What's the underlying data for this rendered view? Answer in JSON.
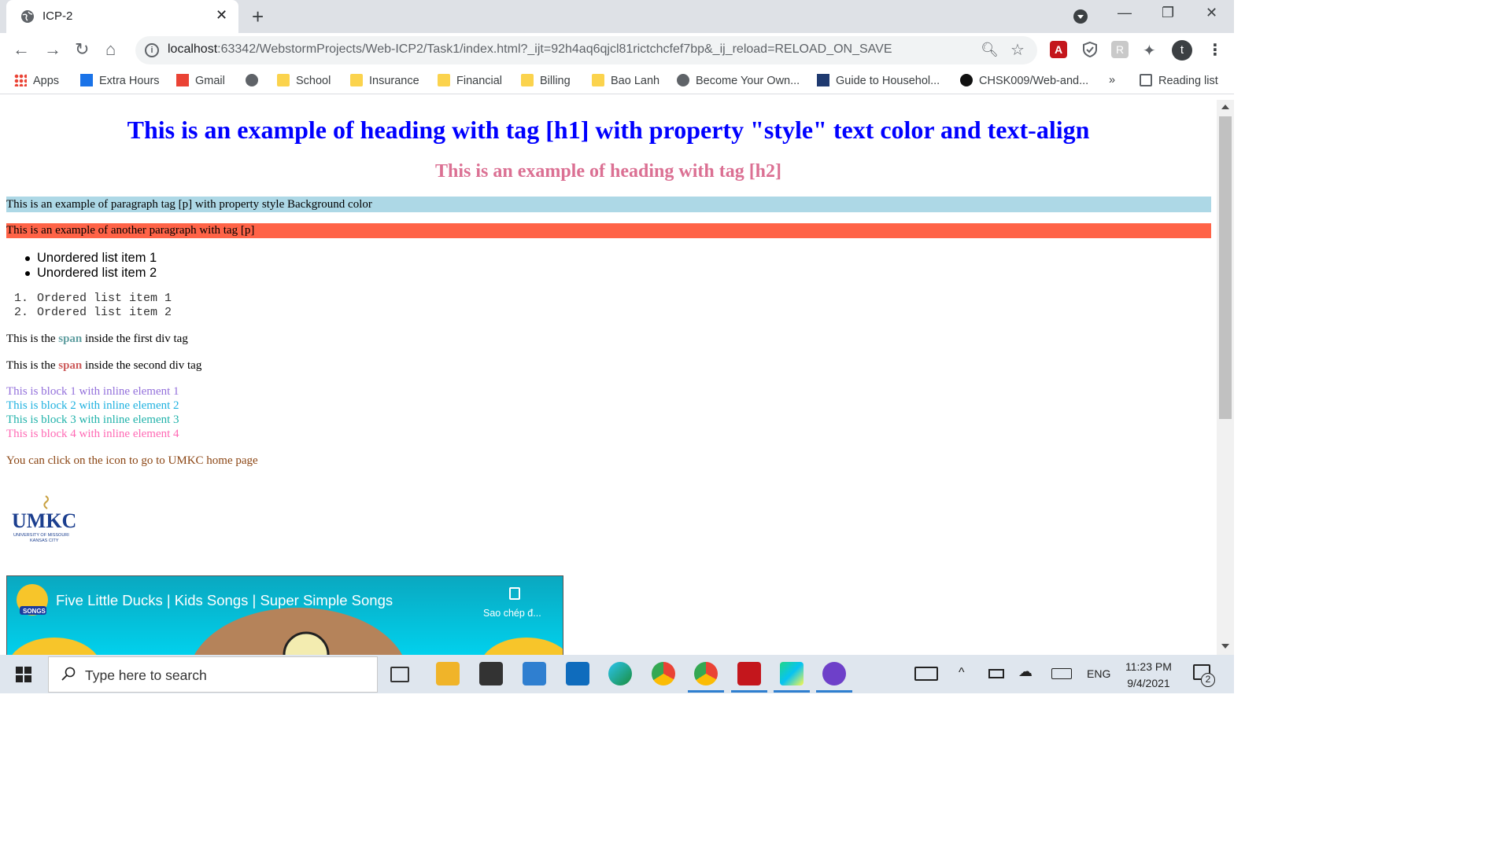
{
  "browser": {
    "tab_title": "ICP-2",
    "new_tab": "+",
    "url_host": "localhost",
    "url_rest": ":63342/WebstormProjects/Web-ICP2/Task1/index.html?_ijt=92h4aq6qjcl81rictchcfef7bp&_ij_reload=RELOAD_ON_SAVE",
    "profile_initial": "t",
    "pdf_ext": "A",
    "r_ext": "R"
  },
  "bookmarks": {
    "apps": "Apps",
    "extra_hours": "Extra Hours",
    "gmail": "Gmail",
    "school": "School",
    "insurance": "Insurance",
    "financial": "Financial",
    "billing": "Billing",
    "bao_lanh": "Bao Lanh",
    "become": "Become Your Own...",
    "guide": "Guide to Househol...",
    "chsk": "CHSK009/Web-and...",
    "more": "»",
    "reading_list": "Reading list"
  },
  "page": {
    "h1": "This is an example of heading with tag [h1] with property \"style\" text color and text-align",
    "h2": "This is an example of heading with tag [h2]",
    "p1": "This is an example of paragraph tag [p] with property style Background color",
    "p2": "This is an example of another paragraph with tag [p]",
    "ul": [
      "Unordered list item 1",
      "Unordered list item 2"
    ],
    "ol": [
      "Ordered list item 1",
      "Ordered list item 2"
    ],
    "ol_nums": [
      "1.",
      "2."
    ],
    "div1_pre": "This is the ",
    "div1_span": "span",
    "div1_post": " inside the first div tag",
    "div2_pre": "This is the ",
    "div2_span": "span",
    "div2_post": " inside the second div tag",
    "blocks": [
      "This is block 1 with inline element 1",
      "This is block 2 with inline element 2",
      "This is block 3 with inline element 3",
      "This is block 4 with inline element 4"
    ],
    "umkc_note": "You can click on the icon to go to UMKC home page",
    "logo_text": "UMKC",
    "logo_sub1": "UNIVERSITY OF MISSOURI",
    "logo_sub2": "KANSAS CITY",
    "video_title": "Five Little Ducks | Kids Songs | Super Simple Songs",
    "video_copy": "Sao chép đ...",
    "video_badge": "SONGS"
  },
  "colors": {
    "h1": "#0000ff",
    "h2": "#db7093",
    "p1_bg": "#add8e6",
    "p2_bg": "#ff6347",
    "span1": "#5f9ea0",
    "span2": "#cd5c5c",
    "block1": "#9370db",
    "block2": "#20b2e0",
    "block3": "#20b2aa",
    "block4": "#ff69b4",
    "umkc_note": "#8b4513"
  },
  "taskbar": {
    "search_placeholder": "Type here to search",
    "lang": "ENG",
    "time": "11:23 PM",
    "date": "9/4/2021",
    "notif_count": "2"
  }
}
